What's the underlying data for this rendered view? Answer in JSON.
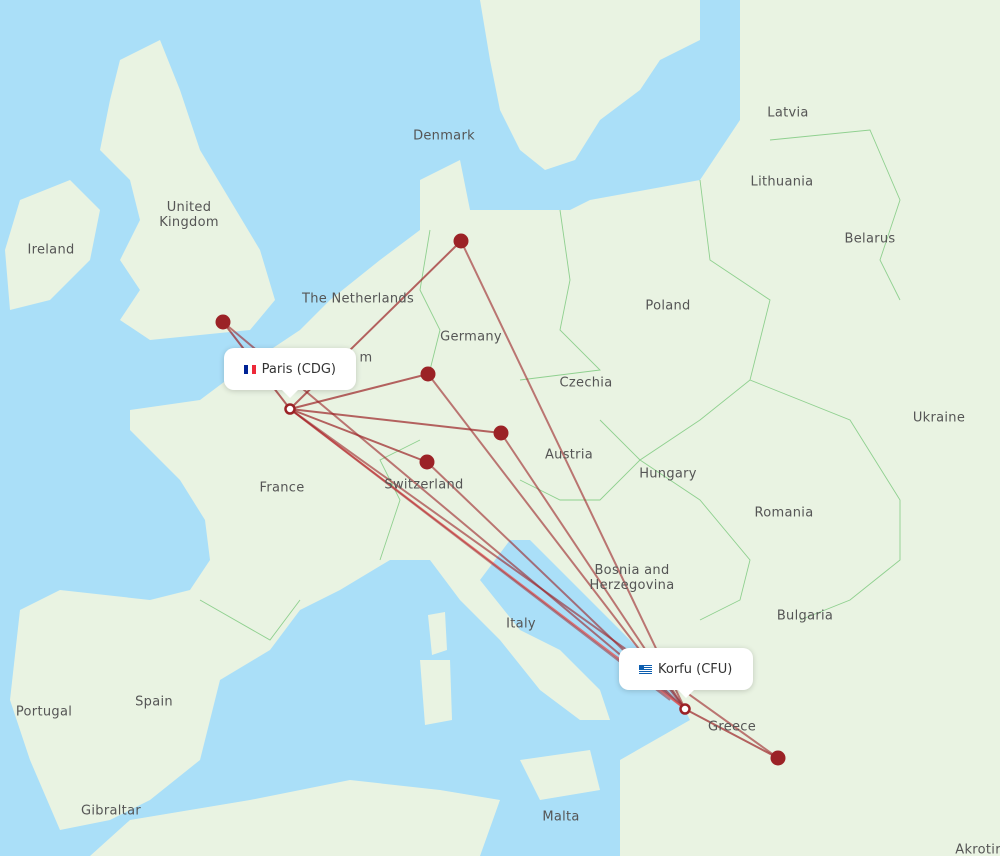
{
  "map": {
    "colors": {
      "water": "#aadff8",
      "land": "#e9f3e2",
      "border": "#8fd08f",
      "route": "#9b2226",
      "route_alt": "#e05a5a"
    },
    "origin": {
      "name": "Paris (CDG)",
      "flag": "fr",
      "label": "Paris (CDG)"
    },
    "destination": {
      "name": "Korfu (CFU)",
      "flag": "gr",
      "label": "Korfu (CFU)"
    },
    "country_labels": [
      "Denmark",
      "Latvia",
      "Lithuania",
      "United Kingdom",
      "Ireland",
      "Belarus",
      "The Netherlands",
      "Poland",
      "Germany",
      "Czechia",
      "Ukraine",
      "Austria",
      "Hungary",
      "Switzerland",
      "France",
      "Romania",
      "Bosnia and Herzegovina",
      "Bulgaria",
      "Italy",
      "Greece",
      "Spain",
      "Portugal",
      "Gibraltar",
      "Malta",
      "Akrotiri"
    ],
    "partial_label": "m",
    "stopover_markers": [
      "London area",
      "Hamburg area",
      "Frankfurt area",
      "Munich area",
      "Zurich area",
      "Athens area"
    ]
  }
}
